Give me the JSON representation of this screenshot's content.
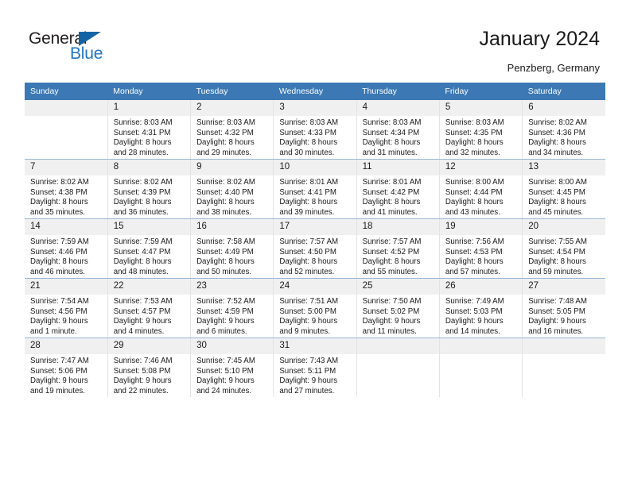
{
  "brand": {
    "name_part1": "General",
    "name_part2": "Blue",
    "accent_color": "#1464a5",
    "text_color": "#231f20"
  },
  "header": {
    "title": "January 2024",
    "subtitle": "Penzberg, Germany",
    "header_bg_color": "#3b78b4",
    "daynum_bg_color": "#f0f0f0"
  },
  "weekday_headers": [
    "Sunday",
    "Monday",
    "Tuesday",
    "Wednesday",
    "Thursday",
    "Friday",
    "Saturday"
  ],
  "weeks": [
    [
      {
        "day": "",
        "sunrise": "",
        "sunset": "",
        "daylight_line1": "",
        "daylight_line2": ""
      },
      {
        "day": "1",
        "sunrise": "Sunrise: 8:03 AM",
        "sunset": "Sunset: 4:31 PM",
        "daylight_line1": "Daylight: 8 hours",
        "daylight_line2": "and 28 minutes."
      },
      {
        "day": "2",
        "sunrise": "Sunrise: 8:03 AM",
        "sunset": "Sunset: 4:32 PM",
        "daylight_line1": "Daylight: 8 hours",
        "daylight_line2": "and 29 minutes."
      },
      {
        "day": "3",
        "sunrise": "Sunrise: 8:03 AM",
        "sunset": "Sunset: 4:33 PM",
        "daylight_line1": "Daylight: 8 hours",
        "daylight_line2": "and 30 minutes."
      },
      {
        "day": "4",
        "sunrise": "Sunrise: 8:03 AM",
        "sunset": "Sunset: 4:34 PM",
        "daylight_line1": "Daylight: 8 hours",
        "daylight_line2": "and 31 minutes."
      },
      {
        "day": "5",
        "sunrise": "Sunrise: 8:03 AM",
        "sunset": "Sunset: 4:35 PM",
        "daylight_line1": "Daylight: 8 hours",
        "daylight_line2": "and 32 minutes."
      },
      {
        "day": "6",
        "sunrise": "Sunrise: 8:02 AM",
        "sunset": "Sunset: 4:36 PM",
        "daylight_line1": "Daylight: 8 hours",
        "daylight_line2": "and 34 minutes."
      }
    ],
    [
      {
        "day": "7",
        "sunrise": "Sunrise: 8:02 AM",
        "sunset": "Sunset: 4:38 PM",
        "daylight_line1": "Daylight: 8 hours",
        "daylight_line2": "and 35 minutes."
      },
      {
        "day": "8",
        "sunrise": "Sunrise: 8:02 AM",
        "sunset": "Sunset: 4:39 PM",
        "daylight_line1": "Daylight: 8 hours",
        "daylight_line2": "and 36 minutes."
      },
      {
        "day": "9",
        "sunrise": "Sunrise: 8:02 AM",
        "sunset": "Sunset: 4:40 PM",
        "daylight_line1": "Daylight: 8 hours",
        "daylight_line2": "and 38 minutes."
      },
      {
        "day": "10",
        "sunrise": "Sunrise: 8:01 AM",
        "sunset": "Sunset: 4:41 PM",
        "daylight_line1": "Daylight: 8 hours",
        "daylight_line2": "and 39 minutes."
      },
      {
        "day": "11",
        "sunrise": "Sunrise: 8:01 AM",
        "sunset": "Sunset: 4:42 PM",
        "daylight_line1": "Daylight: 8 hours",
        "daylight_line2": "and 41 minutes."
      },
      {
        "day": "12",
        "sunrise": "Sunrise: 8:00 AM",
        "sunset": "Sunset: 4:44 PM",
        "daylight_line1": "Daylight: 8 hours",
        "daylight_line2": "and 43 minutes."
      },
      {
        "day": "13",
        "sunrise": "Sunrise: 8:00 AM",
        "sunset": "Sunset: 4:45 PM",
        "daylight_line1": "Daylight: 8 hours",
        "daylight_line2": "and 45 minutes."
      }
    ],
    [
      {
        "day": "14",
        "sunrise": "Sunrise: 7:59 AM",
        "sunset": "Sunset: 4:46 PM",
        "daylight_line1": "Daylight: 8 hours",
        "daylight_line2": "and 46 minutes."
      },
      {
        "day": "15",
        "sunrise": "Sunrise: 7:59 AM",
        "sunset": "Sunset: 4:47 PM",
        "daylight_line1": "Daylight: 8 hours",
        "daylight_line2": "and 48 minutes."
      },
      {
        "day": "16",
        "sunrise": "Sunrise: 7:58 AM",
        "sunset": "Sunset: 4:49 PM",
        "daylight_line1": "Daylight: 8 hours",
        "daylight_line2": "and 50 minutes."
      },
      {
        "day": "17",
        "sunrise": "Sunrise: 7:57 AM",
        "sunset": "Sunset: 4:50 PM",
        "daylight_line1": "Daylight: 8 hours",
        "daylight_line2": "and 52 minutes."
      },
      {
        "day": "18",
        "sunrise": "Sunrise: 7:57 AM",
        "sunset": "Sunset: 4:52 PM",
        "daylight_line1": "Daylight: 8 hours",
        "daylight_line2": "and 55 minutes."
      },
      {
        "day": "19",
        "sunrise": "Sunrise: 7:56 AM",
        "sunset": "Sunset: 4:53 PM",
        "daylight_line1": "Daylight: 8 hours",
        "daylight_line2": "and 57 minutes."
      },
      {
        "day": "20",
        "sunrise": "Sunrise: 7:55 AM",
        "sunset": "Sunset: 4:54 PM",
        "daylight_line1": "Daylight: 8 hours",
        "daylight_line2": "and 59 minutes."
      }
    ],
    [
      {
        "day": "21",
        "sunrise": "Sunrise: 7:54 AM",
        "sunset": "Sunset: 4:56 PM",
        "daylight_line1": "Daylight: 9 hours",
        "daylight_line2": "and 1 minute."
      },
      {
        "day": "22",
        "sunrise": "Sunrise: 7:53 AM",
        "sunset": "Sunset: 4:57 PM",
        "daylight_line1": "Daylight: 9 hours",
        "daylight_line2": "and 4 minutes."
      },
      {
        "day": "23",
        "sunrise": "Sunrise: 7:52 AM",
        "sunset": "Sunset: 4:59 PM",
        "daylight_line1": "Daylight: 9 hours",
        "daylight_line2": "and 6 minutes."
      },
      {
        "day": "24",
        "sunrise": "Sunrise: 7:51 AM",
        "sunset": "Sunset: 5:00 PM",
        "daylight_line1": "Daylight: 9 hours",
        "daylight_line2": "and 9 minutes."
      },
      {
        "day": "25",
        "sunrise": "Sunrise: 7:50 AM",
        "sunset": "Sunset: 5:02 PM",
        "daylight_line1": "Daylight: 9 hours",
        "daylight_line2": "and 11 minutes."
      },
      {
        "day": "26",
        "sunrise": "Sunrise: 7:49 AM",
        "sunset": "Sunset: 5:03 PM",
        "daylight_line1": "Daylight: 9 hours",
        "daylight_line2": "and 14 minutes."
      },
      {
        "day": "27",
        "sunrise": "Sunrise: 7:48 AM",
        "sunset": "Sunset: 5:05 PM",
        "daylight_line1": "Daylight: 9 hours",
        "daylight_line2": "and 16 minutes."
      }
    ],
    [
      {
        "day": "28",
        "sunrise": "Sunrise: 7:47 AM",
        "sunset": "Sunset: 5:06 PM",
        "daylight_line1": "Daylight: 9 hours",
        "daylight_line2": "and 19 minutes."
      },
      {
        "day": "29",
        "sunrise": "Sunrise: 7:46 AM",
        "sunset": "Sunset: 5:08 PM",
        "daylight_line1": "Daylight: 9 hours",
        "daylight_line2": "and 22 minutes."
      },
      {
        "day": "30",
        "sunrise": "Sunrise: 7:45 AM",
        "sunset": "Sunset: 5:10 PM",
        "daylight_line1": "Daylight: 9 hours",
        "daylight_line2": "and 24 minutes."
      },
      {
        "day": "31",
        "sunrise": "Sunrise: 7:43 AM",
        "sunset": "Sunset: 5:11 PM",
        "daylight_line1": "Daylight: 9 hours",
        "daylight_line2": "and 27 minutes."
      },
      {
        "day": "",
        "sunrise": "",
        "sunset": "",
        "daylight_line1": "",
        "daylight_line2": ""
      },
      {
        "day": "",
        "sunrise": "",
        "sunset": "",
        "daylight_line1": "",
        "daylight_line2": ""
      },
      {
        "day": "",
        "sunrise": "",
        "sunset": "",
        "daylight_line1": "",
        "daylight_line2": ""
      }
    ]
  ]
}
